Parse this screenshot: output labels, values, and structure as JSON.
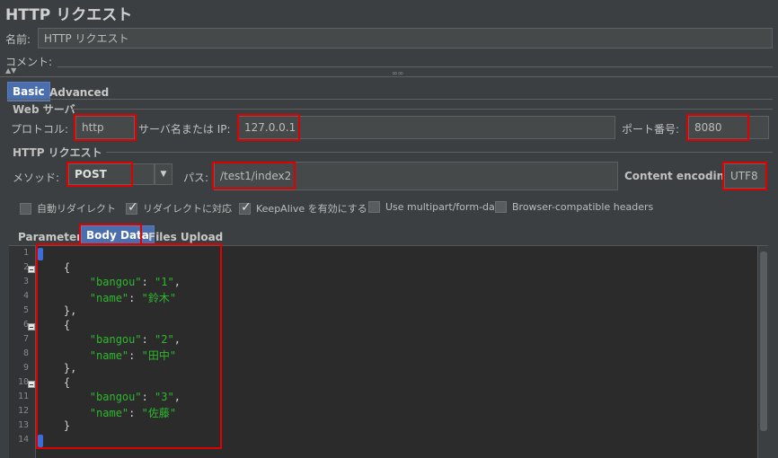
{
  "window": {
    "title": "HTTP リクエスト"
  },
  "name_field": {
    "label": "名前:",
    "value": "HTTP リクエスト"
  },
  "comment_field": {
    "label": "コメント:",
    "value": ""
  },
  "config_tabs": [
    {
      "label": "Basic",
      "active": true
    },
    {
      "label": "Advanced",
      "active": false
    }
  ],
  "web_server": {
    "section_title": "Web サーバ",
    "protocol_label": "プロトコル:",
    "protocol_value": "http",
    "server_label": "サーバ名または IP:",
    "server_value": "127.0.0.1",
    "port_label": "ポート番号:",
    "port_value": "8080"
  },
  "http_request": {
    "section_title": "HTTP リクエスト",
    "method_label": "メソッド:",
    "method_value": "POST",
    "path_label": "パス:",
    "path_value": "/test1/index2",
    "encoding_label": "Content encoding:",
    "encoding_value": "UTF8"
  },
  "options": [
    {
      "label": "自動リダイレクト",
      "checked": false
    },
    {
      "label": "リダイレクトに対応",
      "checked": true
    },
    {
      "label": "KeepAlive を有効にする",
      "checked": true
    },
    {
      "label": "Use multipart/form-data",
      "checked": false
    },
    {
      "label": "Browser-compatible headers",
      "checked": false
    }
  ],
  "body_tabs": [
    {
      "label": "Parameters",
      "active": false
    },
    {
      "label": "Body Data",
      "active": true
    },
    {
      "label": "Files Upload",
      "active": false
    }
  ],
  "editor": {
    "lines": [
      {
        "num": "1",
        "fold": false,
        "indent": "",
        "parts": []
      },
      {
        "num": "2",
        "fold": true,
        "indent": "    ",
        "parts": [
          {
            "t": "{",
            "s": false
          }
        ]
      },
      {
        "num": "3",
        "fold": false,
        "indent": "        ",
        "parts": [
          {
            "t": "\"bangou\"",
            "s": true
          },
          {
            "t": ": ",
            "s": false
          },
          {
            "t": "\"1\"",
            "s": true
          },
          {
            "t": ",",
            "s": false
          }
        ]
      },
      {
        "num": "4",
        "fold": false,
        "indent": "        ",
        "parts": [
          {
            "t": "\"name\"",
            "s": true
          },
          {
            "t": ": ",
            "s": false
          },
          {
            "t": "\"鈴木\"",
            "s": true
          }
        ]
      },
      {
        "num": "5",
        "fold": false,
        "indent": "    ",
        "parts": [
          {
            "t": "},",
            "s": false
          }
        ]
      },
      {
        "num": "6",
        "fold": true,
        "indent": "    ",
        "parts": [
          {
            "t": "{",
            "s": false
          }
        ]
      },
      {
        "num": "7",
        "fold": false,
        "indent": "        ",
        "parts": [
          {
            "t": "\"bangou\"",
            "s": true
          },
          {
            "t": ": ",
            "s": false
          },
          {
            "t": "\"2\"",
            "s": true
          },
          {
            "t": ",",
            "s": false
          }
        ]
      },
      {
        "num": "8",
        "fold": false,
        "indent": "        ",
        "parts": [
          {
            "t": "\"name\"",
            "s": true
          },
          {
            "t": ": ",
            "s": false
          },
          {
            "t": "\"田中\"",
            "s": true
          }
        ]
      },
      {
        "num": "9",
        "fold": false,
        "indent": "    ",
        "parts": [
          {
            "t": "},",
            "s": false
          }
        ]
      },
      {
        "num": "10",
        "fold": true,
        "indent": "    ",
        "parts": [
          {
            "t": "{",
            "s": false
          }
        ]
      },
      {
        "num": "11",
        "fold": false,
        "indent": "        ",
        "parts": [
          {
            "t": "\"bangou\"",
            "s": true
          },
          {
            "t": ": ",
            "s": false
          },
          {
            "t": "\"3\"",
            "s": true
          },
          {
            "t": ",",
            "s": false
          }
        ]
      },
      {
        "num": "12",
        "fold": false,
        "indent": "        ",
        "parts": [
          {
            "t": "\"name\"",
            "s": true
          },
          {
            "t": ": ",
            "s": false
          },
          {
            "t": "\"佐藤\"",
            "s": true
          }
        ]
      },
      {
        "num": "13",
        "fold": false,
        "indent": "    ",
        "parts": [
          {
            "t": "}",
            "s": false
          }
        ]
      },
      {
        "num": "14",
        "fold": false,
        "indent": "",
        "parts": []
      }
    ]
  },
  "colors": {
    "highlight": "#e00000",
    "string": "#2eb82e",
    "active_tab": "#4b6eaf",
    "caret": "#3d6dd8"
  }
}
